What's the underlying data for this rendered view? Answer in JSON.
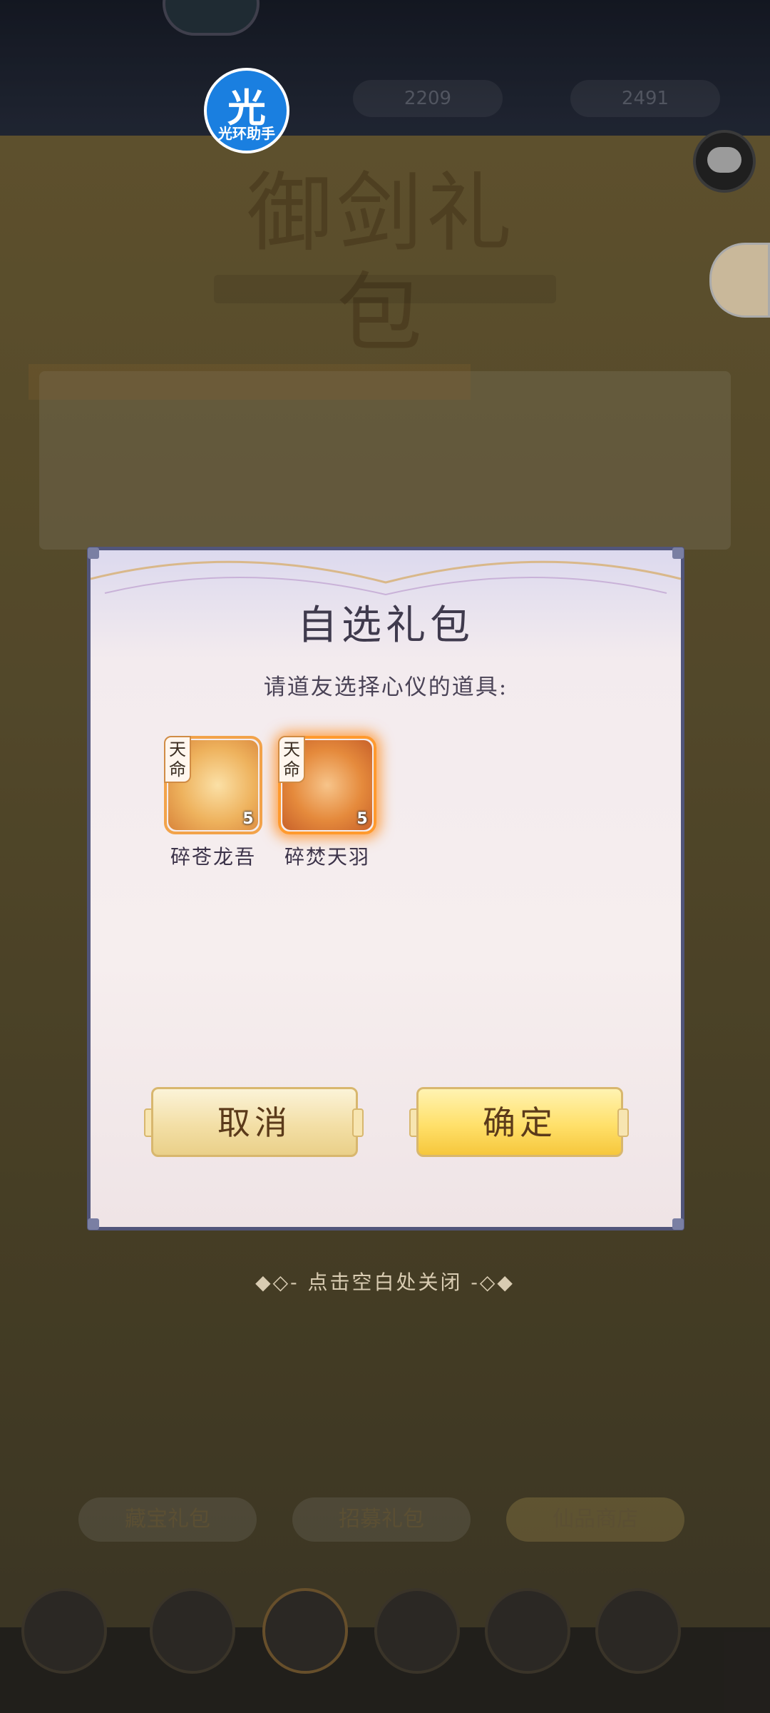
{
  "background": {
    "resource_1": "2209",
    "resource_2": "2491",
    "gift_title": "御剑礼包",
    "gift_subtitle": "",
    "card_title": "",
    "tabs": [
      "藏宝礼包",
      "招募礼包",
      "仙品商店"
    ]
  },
  "overlay": {
    "assistant_badge_char": "光",
    "assistant_badge_text": "光环助手"
  },
  "dialog": {
    "title": "自选礼包",
    "prompt": "请道友选择心仪的道具:",
    "items": [
      {
        "tag": "天命",
        "count": "5",
        "name": "碎苍龙吾",
        "selected": false
      },
      {
        "tag": "天命",
        "count": "5",
        "name": "碎焚天羽",
        "selected": true
      }
    ],
    "cancel_label": "取消",
    "confirm_label": "确定"
  },
  "close_hint": "◆◇- 点击空白处关闭 -◇◆",
  "colors": {
    "dialog_border": "#51557a",
    "item_border": "#f2a34a",
    "confirm_button": "#ffe06a"
  }
}
